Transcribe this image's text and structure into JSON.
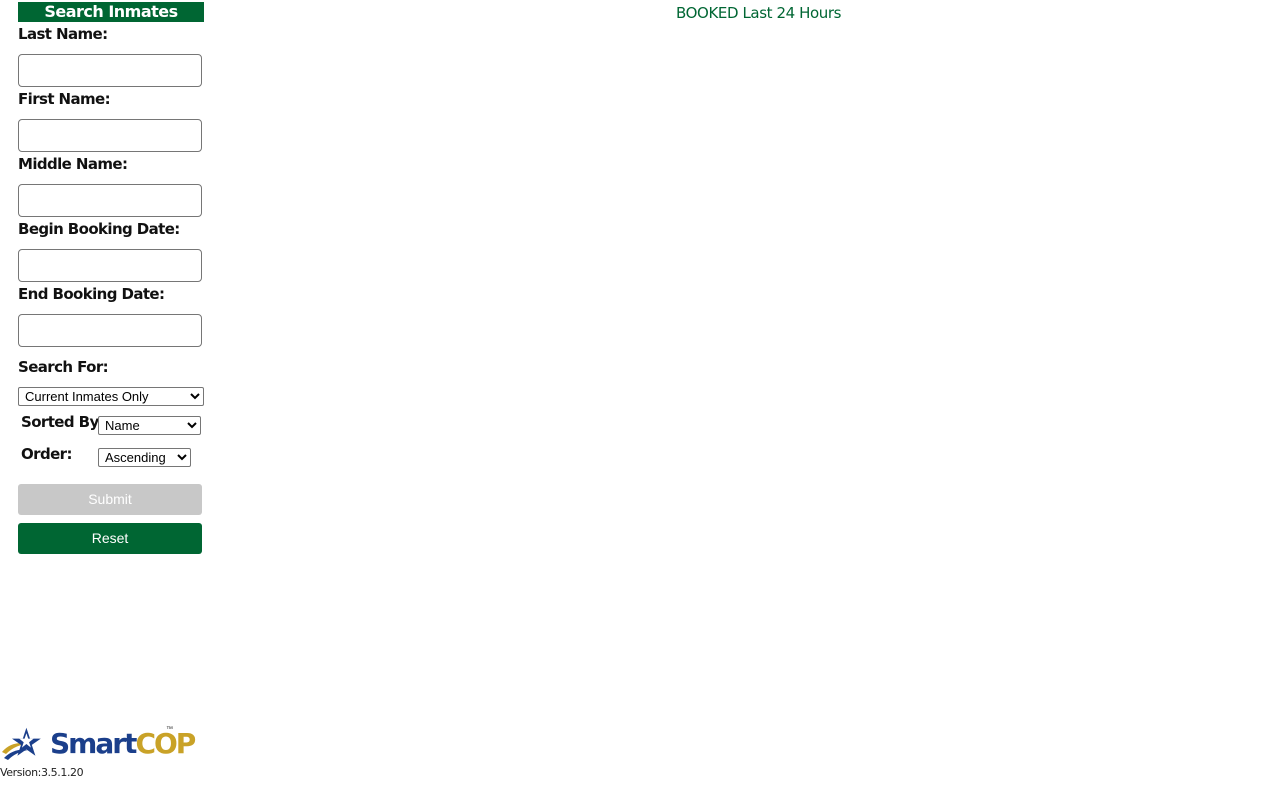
{
  "sidebar": {
    "header": "Search Inmates",
    "last_name_label": "Last Name:",
    "first_name_label": "First Name:",
    "middle_name_label": "Middle Name:",
    "begin_date_label": "Begin Booking Date:",
    "end_date_label": "End Booking Date:",
    "search_for_label": "Search For:",
    "search_for_value": "Current Inmates Only",
    "sorted_by_label": "Sorted By:",
    "sorted_by_value": "Name",
    "order_label": "Order:",
    "order_value": "Ascending",
    "submit_label": "Submit",
    "reset_label": "Reset"
  },
  "main": {
    "booked_link": "BOOKED Last 24 Hours"
  },
  "footer": {
    "logo_smart": "Smart",
    "logo_cop": "COP",
    "logo_tm": "™",
    "version": "Version:3.5.1.20"
  },
  "colors": {
    "brand_green": "#006633",
    "disabled_gray": "#c8c8c8",
    "logo_blue": "#1b3f8b",
    "logo_gold": "#c9a227"
  }
}
